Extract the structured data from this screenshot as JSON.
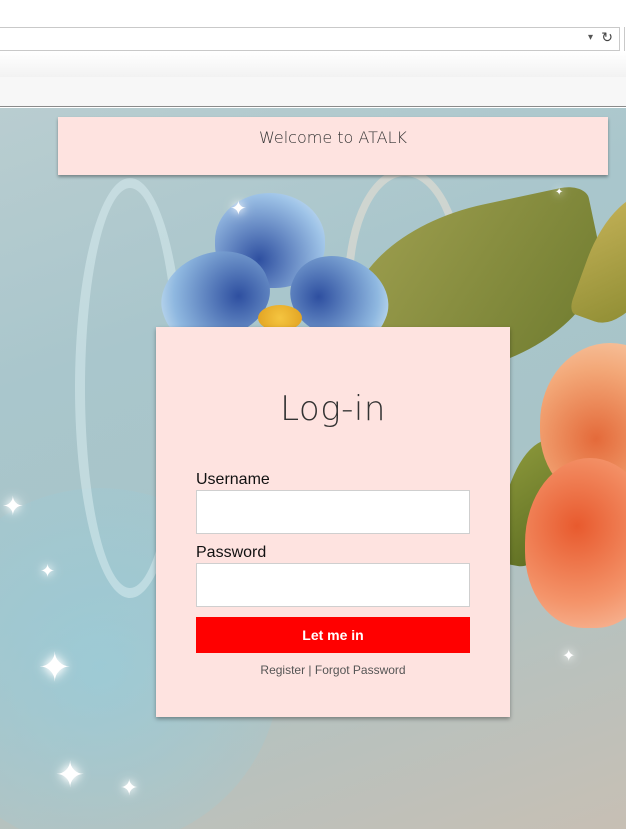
{
  "browser": {
    "address_value": "",
    "dropdown_icon": "chevron-down-icon",
    "refresh_icon": "refresh-icon"
  },
  "banner": {
    "text": "Welcome to ATALK"
  },
  "login": {
    "title": "Log-in",
    "username_label": "Username",
    "username_value": "",
    "password_label": "Password",
    "password_value": "",
    "submit_label": "Let me in",
    "register_link": "Register",
    "separator": " | ",
    "forgot_link": "Forgot Password"
  },
  "colors": {
    "card_background": "#fee3e0",
    "button": "#ff0000",
    "button_text": "#ffffff"
  }
}
